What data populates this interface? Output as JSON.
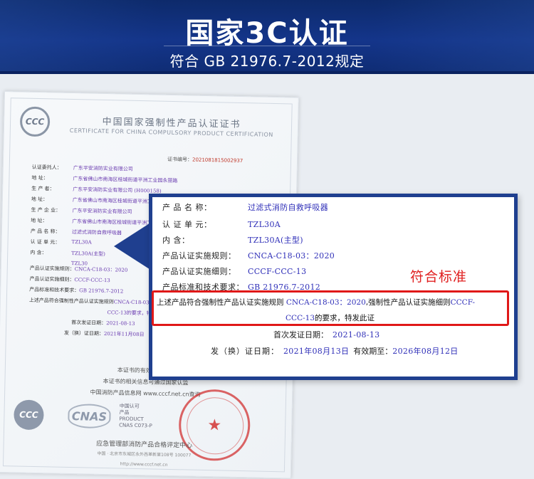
{
  "banner": {
    "title": "国家3C认证",
    "subtitle": "符合  GB 21976.7-2012规定"
  },
  "certificate": {
    "logo_text": "CCC",
    "title_cn": "中国国家强制性产品认证证书",
    "title_en": "CERTIFICATE FOR CHINA COMPULSORY PRODUCT CERTIFICATION",
    "cert_no_label": "证书编号：",
    "cert_no_value": "2021081815002937",
    "rows": [
      {
        "label": "认证委托人：",
        "value": "广东平安消防实业有限公司"
      },
      {
        "label": "地        址：",
        "value": "广东省佛山市南海区桂城街道平洲工业园永丽路"
      },
      {
        "label": "生   产   者：",
        "value": "广东平安消防实业有限公司 (H000158)"
      },
      {
        "label": "地        址：",
        "value": "广东省佛山市南海区桂城街道平洲工业园永丽路"
      },
      {
        "label": "生 产 企 业：",
        "value": "广东平安消防实业有限公司"
      },
      {
        "label": "地        址：",
        "value": "广东省佛山市南海区桂城街道平洲工业园永丽路"
      },
      {
        "label": "产 品 名 称：",
        "value": "过滤式消防自救呼吸器"
      },
      {
        "label": "认 证 单 元：",
        "value": "TZL30A"
      },
      {
        "label": "内        含：",
        "value": "TZL30A(主型)"
      },
      {
        "label": "",
        "value": "TZL30"
      }
    ],
    "lower_rows": [
      {
        "label": "产品认证实施规则：",
        "value": "CNCA-C18-03：2020"
      },
      {
        "label": "产品认证实施细则：",
        "value": "CCCF-CCC-13"
      },
      {
        "label": "产品标准和技术要求：",
        "value": "GB 21976.7-2012"
      },
      {
        "label": "上述产品符合强制性产品认证实施规则",
        "value": "CNCA-C18-03：2020"
      },
      {
        "label": "",
        "value": "CCC-13的要求，特发此证"
      },
      {
        "label": "首次发证日期：",
        "value": "2021-08-13"
      },
      {
        "label": "发（换）证日期：",
        "value": "2021年11月08日"
      }
    ],
    "note_1": "本证书的有效性需依靠",
    "note_2": "本证书的相关信息可通过国家认监",
    "note_3": "中国消防产品信息网",
    "note_3_url": "www.cccf.net.cn查询",
    "logo_ccc": "CCC",
    "logo_cnas": "CNAS",
    "cnas_lines": [
      "中国认可",
      "产品",
      "PRODUCT",
      "CNAS C073-P"
    ],
    "footer_org": "应急管理部消防产品合格评定中心",
    "footer_addr": "中国 · 北京市东城区永外西革新里108号    100077",
    "footer_url": "http://www.cccf.net.cn"
  },
  "callout": {
    "rows": [
      {
        "label": "产  品  名  称：",
        "value": "过滤式消防自救呼吸器"
      },
      {
        "label": "认  证  单  元：",
        "value": "TZL30A"
      },
      {
        "label": "内          含：",
        "value": "TZL30A(主型)"
      },
      {
        "label": "产品认证实施规则：",
        "value": "CNCA-C18-03：2020"
      },
      {
        "label": "产品认证实施细则：",
        "value": "CCCF-CCC-13"
      },
      {
        "label": "产品标准和技术要求：",
        "value": "GB 21976.7-2012"
      }
    ],
    "compliance_label": "符合标准",
    "statement_prefix": "上述产品符合强制性产品认证实施规则",
    "statement_rule": "CNCA-C18-03：2020",
    "statement_mid": ",强制性产品认证实施细则",
    "statement_rule2": "CCCF-",
    "statement_rule2_cont": "CCC-13",
    "statement_suffix": "的要求，特发此证",
    "first_issue_label": "首次发证日期：",
    "first_issue_value": "2021-08-13",
    "issue_label": "发（换）证日期：",
    "issue_value": "2021年08月13日",
    "valid_label": "有效期至：",
    "valid_value": "2026年08月12日"
  },
  "colors": {
    "banner_blue": "#14358a",
    "callout_border": "#1f3f8f",
    "highlight_red": "#e01818",
    "value_blue": "#2f2fb8"
  }
}
